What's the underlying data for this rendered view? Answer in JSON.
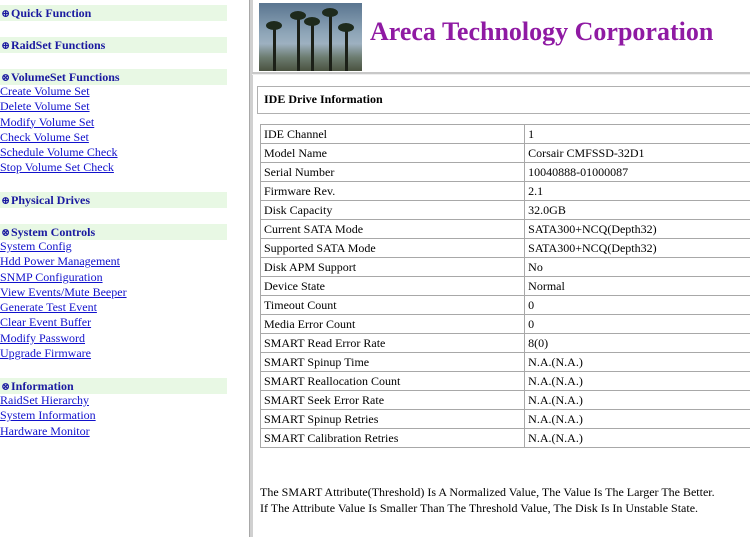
{
  "nav": {
    "quick": {
      "symbol": "⊕",
      "label": "Quick Function"
    },
    "raidset": {
      "symbol": "⊕",
      "label": "RaidSet Functions"
    },
    "volumeset": {
      "symbol": "⊗",
      "label": "VolumeSet Functions",
      "links": [
        "Create Volume Set",
        "Delete Volume Set",
        "Modify Volume Set",
        "Check Volume Set",
        "Schedule Volume Check",
        "Stop Volume Set Check"
      ]
    },
    "physical": {
      "symbol": "⊕",
      "label": "Physical Drives"
    },
    "system": {
      "symbol": "⊗",
      "label": "System Controls",
      "links": [
        "System Config",
        "Hdd Power Management",
        "SNMP Configuration",
        "View Events/Mute Beeper",
        "Generate Test Event",
        "Clear Event Buffer",
        "Modify Password",
        "Upgrade Firmware"
      ]
    },
    "information": {
      "symbol": "⊗",
      "label": "Information",
      "links": [
        "RaidSet Hierarchy",
        "System Information",
        "Hardware Monitor"
      ]
    }
  },
  "header": {
    "company": "Areca Technology Corporation"
  },
  "content": {
    "title": "IDE Drive Information",
    "rows": [
      [
        "IDE Channel",
        "1"
      ],
      [
        "Model Name",
        "Corsair CMFSSD-32D1"
      ],
      [
        "Serial Number",
        "10040888-01000087"
      ],
      [
        "Firmware Rev.",
        "2.1"
      ],
      [
        "Disk Capacity",
        "32.0GB"
      ],
      [
        "Current SATA Mode",
        "SATA300+NCQ(Depth32)"
      ],
      [
        "Supported SATA Mode",
        "SATA300+NCQ(Depth32)"
      ],
      [
        "Disk APM Support",
        "No"
      ],
      [
        "Device State",
        "Normal"
      ],
      [
        "Timeout Count",
        "0"
      ],
      [
        "Media Error Count",
        "0"
      ],
      [
        "SMART Read Error Rate",
        "8(0)"
      ],
      [
        "SMART Spinup Time",
        "N.A.(N.A.)"
      ],
      [
        "SMART Reallocation Count",
        "N.A.(N.A.)"
      ],
      [
        "SMART Seek Error Rate",
        "N.A.(N.A.)"
      ],
      [
        "SMART Spinup Retries",
        "N.A.(N.A.)"
      ],
      [
        "SMART Calibration Retries",
        "N.A.(N.A.)"
      ]
    ],
    "note_line1": "The SMART Attribute(Threshold) Is A Normalized Value, The Value Is The Larger The Better.",
    "note_line2": "If The Attribute Value Is Smaller Than The Threshold Value, The Disk Is In Unstable State."
  }
}
